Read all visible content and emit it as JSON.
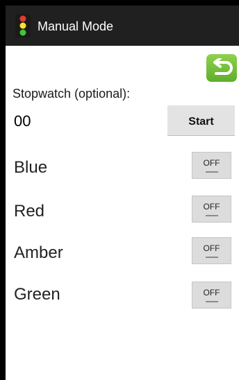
{
  "header": {
    "title": "Manual Mode",
    "app_icon": "traffic-light-icon"
  },
  "back_button": {
    "icon": "back-arrow-icon",
    "color": "#6cbf36"
  },
  "stopwatch": {
    "label": "Stopwatch (optional):",
    "value": "00",
    "start_label": "Start"
  },
  "lights": [
    {
      "label": "Blue",
      "state": "OFF"
    },
    {
      "label": "Red",
      "state": "OFF"
    },
    {
      "label": "Amber",
      "state": "OFF"
    },
    {
      "label": "Green",
      "state": "OFF"
    }
  ]
}
